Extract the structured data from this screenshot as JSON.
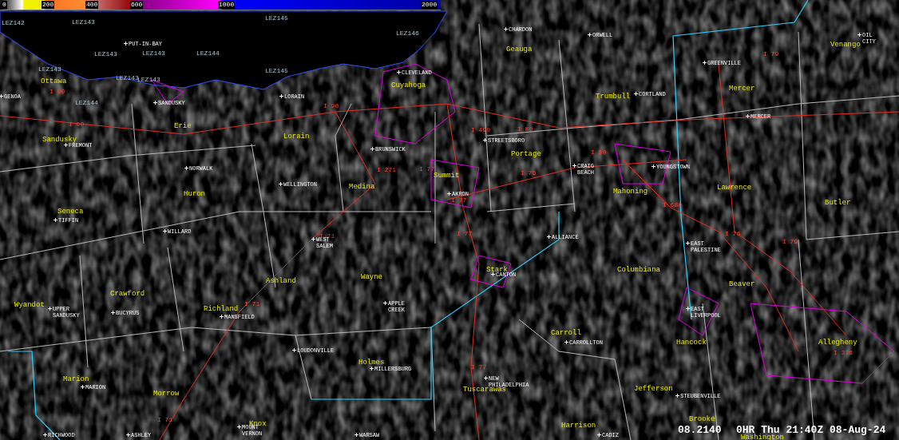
{
  "colorbar": {
    "ticks": [
      "0",
      "200",
      "400",
      "600",
      "1000",
      "2000"
    ]
  },
  "lake_zones": [
    "LEZ142",
    "LEZ143",
    "LEZ145",
    "LEZ143",
    "LEZ143",
    "LEZ144",
    "LEZ146",
    "LEZ143",
    "LEZ145",
    "LEZ143",
    "LEZ143",
    "LEZ144"
  ],
  "counties": [
    "Ottawa",
    "Sandusky",
    "Erie",
    "Lorain",
    "Cuyahoga",
    "Geauga",
    "Trumbull",
    "Mercer",
    "Venango",
    "Medina",
    "Summit",
    "Portage",
    "Mahoning",
    "Lawrence",
    "Butler",
    "Huron",
    "Seneca",
    "Crawford",
    "Wyandot",
    "Richland",
    "Ashland",
    "Wayne",
    "Stark",
    "Columbiana",
    "Beaver",
    "Marion",
    "Morrow",
    "Knox",
    "Holmes",
    "Carroll",
    "Hancock",
    "Allegheny",
    "Tuscarawas",
    "Jefferson",
    "Harrison",
    "Brooke",
    "Washington"
  ],
  "cities": [
    "CHARDON",
    "ORWELL",
    "OIL CITY",
    "GREENVILLE",
    "CORTLAND",
    "PUT-IN-BAY",
    "SANDUSKY",
    "GENOA",
    "CLEVELAND",
    "LORAIN",
    "MERCER",
    "STREETSBORO",
    "BRUNSWICK",
    "FREMONT",
    "NORWALK",
    "WELLINGTON",
    "CRAIG BEACH",
    "YOUNGSTOWN",
    "AKRON",
    "TIFFIN",
    "WILLARD",
    "WEST SALEM",
    "ALLIANCE",
    "EAST PALESTINE",
    "CANTON",
    "UPPER SANDUSKY",
    "BUCYRUS",
    "MANSFIELD",
    "APPLE CREEK",
    "EAST LIVERPOOL",
    "LOUDONVILLE",
    "MILLERSBURG",
    "CARROLLTON",
    "NEW PHILADELPHIA",
    "STEUBENVILLE",
    "MARION",
    "RICHWOOD",
    "ASHLEY",
    "MOUNT VERNON",
    "WARSAW",
    "CADIZ"
  ],
  "interstates": [
    "I 90",
    "I 90",
    "I 490",
    "I 80",
    "I 80",
    "I 76",
    "I 680",
    "I 77",
    "I 77",
    "I 271",
    "I 77",
    "I 71",
    "I 71",
    "I 71",
    "I 79",
    "I 76",
    "I 79",
    "I 376",
    "I 77",
    "I 90"
  ],
  "status": {
    "product": "08.2140",
    "valid_time": "0HR Thu 21:40Z 08-Aug-24"
  }
}
